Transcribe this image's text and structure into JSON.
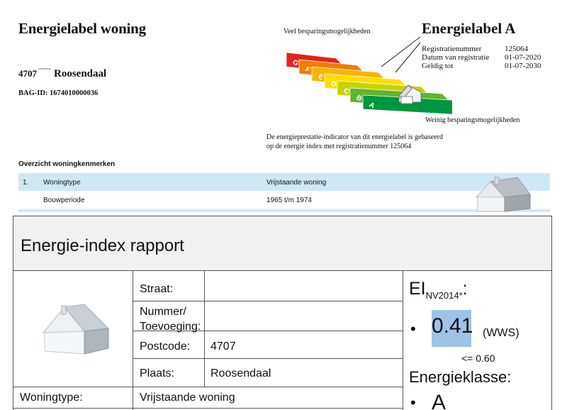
{
  "label": {
    "title": "Energielabel woning",
    "postcode": "4707",
    "city": "Roosendaal",
    "bag_id": "BAG-ID: 1674010000036",
    "label_heading": "Energielabel A",
    "registration": [
      {
        "key": "Registratienummer",
        "value": "125064"
      },
      {
        "key": "Datum van registratie",
        "value": "01-07-2020"
      },
      {
        "key": "Geldig tot",
        "value": "01-07-2030"
      }
    ],
    "scale_high_note": "Veel besparingsmogelijkheden",
    "scale_low_note": "Weinig besparingsmogelijkheden",
    "scale_classes": [
      "G",
      "F",
      "E",
      "D",
      "C",
      "B",
      "A"
    ],
    "scale_colors": [
      "#e2231a",
      "#ef7d00",
      "#f8b400",
      "#ffdd00",
      "#c7d300",
      "#5fb52e",
      "#009640"
    ],
    "current_class": "A",
    "indicator_text_1": "De energieprestatie-indicator van dit energielabel is gebaseerd",
    "indicator_text_2": "op de energie index met registratienummer 125064"
  },
  "overview": {
    "title": "Overzicht woningkenmerken",
    "rows": [
      {
        "index": "1.",
        "key": "Woningtype",
        "value": "Vrijstaande woning"
      },
      {
        "index": "",
        "key": "Bouwperiode",
        "value": "1965 t/m 1974"
      }
    ]
  },
  "report": {
    "title": "Energie-index rapport",
    "fields": [
      {
        "key": "Straat:",
        "value": ""
      },
      {
        "key": "Nummer/ Toevoeging:",
        "value": ""
      },
      {
        "key": "Postcode:",
        "value": "4707"
      },
      {
        "key": "Plaats:",
        "value": "Roosendaal"
      }
    ],
    "woningtype_key": "Woningtype:",
    "woningtype_value": "Vrijstaande woning",
    "ei_label": "EI",
    "ei_sub": "NV2014*",
    "ei_colon": ":",
    "ei_value": "0.41",
    "ei_unit": "(WWS)",
    "ei_limit": "<= 0.60",
    "class_label": "Energieklasse:",
    "class_value": "A",
    "bullet": "•"
  }
}
